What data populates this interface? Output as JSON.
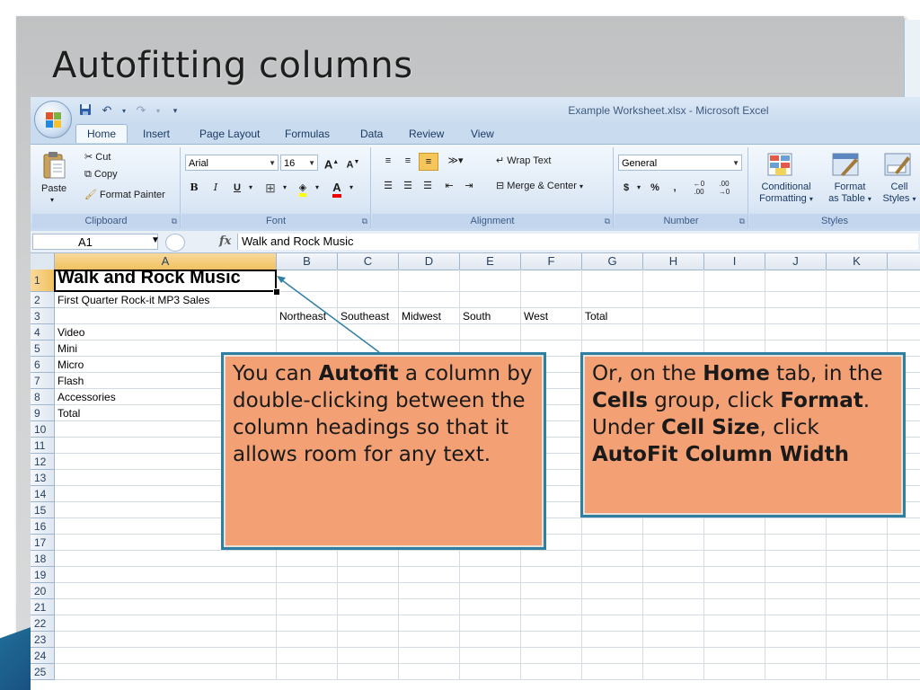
{
  "slide": {
    "title": "Autofitting columns"
  },
  "excel": {
    "window_title": "Example Worksheet.xlsx - Microsoft Excel",
    "qat": [
      "save-icon",
      "undo-icon",
      "redo-icon",
      "customize-icon"
    ],
    "tabs": [
      "Home",
      "Insert",
      "Page Layout",
      "Formulas",
      "Data",
      "Review",
      "View"
    ],
    "active_tab": "Home",
    "ribbon": {
      "clipboard": {
        "label": "Clipboard",
        "paste": "Paste",
        "cut": "Cut",
        "copy": "Copy",
        "format_painter": "Format Painter"
      },
      "font": {
        "label": "Font",
        "font_name": "Arial",
        "font_size": "16",
        "bold": "B",
        "italic": "I",
        "underline": "U",
        "grow": "A",
        "shrink": "A"
      },
      "alignment": {
        "label": "Alignment",
        "wrap_text": "Wrap Text",
        "merge_center": "Merge & Center"
      },
      "number": {
        "label": "Number",
        "format": "General",
        "currency": "$",
        "percent": "%",
        "comma": ","
      },
      "styles": {
        "label": "Styles",
        "conditional_1": "Conditional",
        "conditional_2": "Formatting",
        "format_table_1": "Format",
        "format_table_2": "as Table",
        "cell_styles_1": "Cell",
        "cell_styles_2": "Styles"
      }
    },
    "formula_bar": {
      "name_box": "A1",
      "fx": "fx",
      "value": "Walk and Rock Music"
    },
    "columns": [
      "A",
      "B",
      "C",
      "D",
      "E",
      "F",
      "G",
      "H",
      "I",
      "J",
      "K"
    ],
    "rows": [
      {
        "n": "1",
        "a": "Walk and Rock Music"
      },
      {
        "n": "2",
        "a": "First Quarter Rock-it MP3 Sales"
      },
      {
        "n": "3",
        "a": "",
        "headers": [
          "Northeast",
          "Southeast",
          "Midwest",
          "South",
          "West",
          "Total"
        ]
      },
      {
        "n": "4",
        "a": "Video"
      },
      {
        "n": "5",
        "a": "Mini"
      },
      {
        "n": "6",
        "a": "Micro"
      },
      {
        "n": "7",
        "a": "Flash"
      },
      {
        "n": "8",
        "a": "Accessories"
      },
      {
        "n": "9",
        "a": "Total"
      },
      {
        "n": "10",
        "a": ""
      },
      {
        "n": "11",
        "a": ""
      },
      {
        "n": "12",
        "a": ""
      },
      {
        "n": "13",
        "a": ""
      },
      {
        "n": "14",
        "a": ""
      },
      {
        "n": "15",
        "a": ""
      },
      {
        "n": "16",
        "a": ""
      },
      {
        "n": "17",
        "a": ""
      },
      {
        "n": "18",
        "a": ""
      },
      {
        "n": "19",
        "a": ""
      },
      {
        "n": "20",
        "a": ""
      },
      {
        "n": "21",
        "a": ""
      },
      {
        "n": "22",
        "a": ""
      },
      {
        "n": "23",
        "a": ""
      },
      {
        "n": "24",
        "a": ""
      },
      {
        "n": "25",
        "a": ""
      }
    ]
  },
  "callout_left": {
    "t1": "You can ",
    "b1": "Autofit",
    "t2": " a column by double-clicking between the column headings so that it allows room for any text."
  },
  "callout_right": {
    "t1": "Or, on the ",
    "b1": "Home",
    "t2": " tab, in the ",
    "b2": "Cells",
    "t3": " group, click ",
    "b3": "Format",
    "t4": ".",
    "t5": "Under ",
    "b4": "Cell Size",
    "t6": ", click ",
    "b5": "AutoFit Column Width"
  },
  "colors": {
    "callout_fill": "#f3a174",
    "callout_border": "#2f7fa3",
    "accent": "#1f6f9a"
  }
}
